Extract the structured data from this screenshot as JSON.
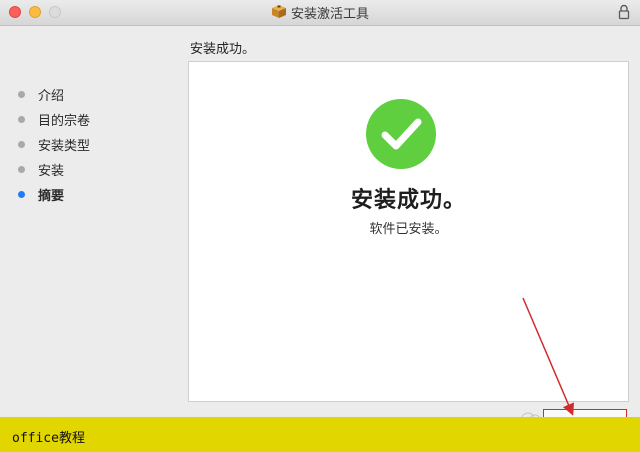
{
  "window": {
    "title": "安装激活工具",
    "icons": {
      "package": "package-icon",
      "lock": "lock-icon"
    }
  },
  "sidebar": {
    "steps": [
      {
        "label": "介绍",
        "active": false
      },
      {
        "label": "目的宗卷",
        "active": false
      },
      {
        "label": "安装类型",
        "active": false
      },
      {
        "label": "安装",
        "active": false
      },
      {
        "label": "摘要",
        "active": true
      }
    ]
  },
  "main": {
    "heading": "安装成功。",
    "success_icon": "checkmark-circle-icon",
    "success_title": "安装成功。",
    "success_subtitle": "软件已安装。"
  },
  "footer": {
    "label": "office教程"
  },
  "colors": {
    "accent": "#1f7cf5",
    "success": "#5fcf3f",
    "annotation": "#d12b2b",
    "footer_bar": "#e2d600"
  }
}
